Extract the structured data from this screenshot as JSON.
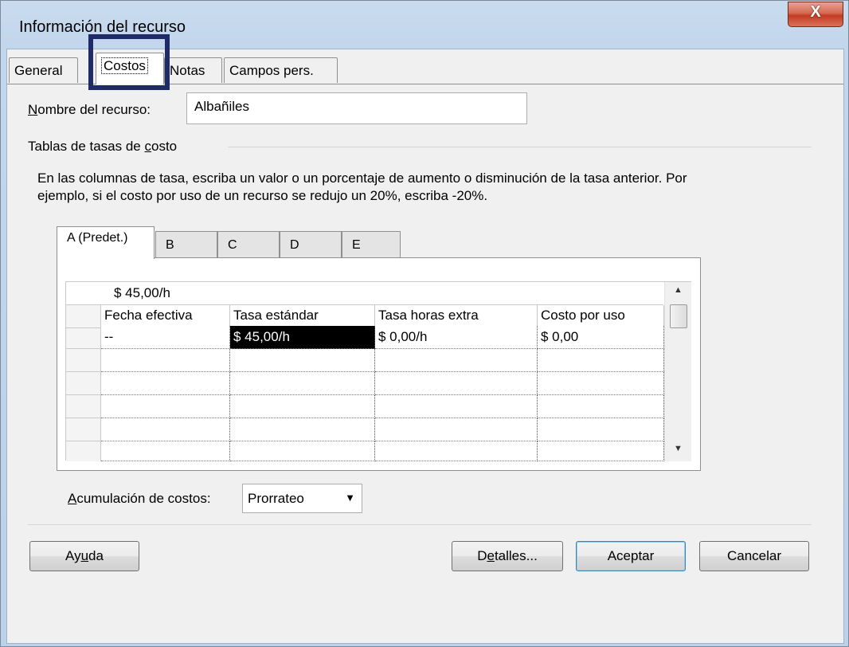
{
  "window": {
    "title": "Información del recurso",
    "close_glyph": "X"
  },
  "tabs": [
    {
      "label": "General"
    },
    {
      "label": "Costos"
    },
    {
      "label": "Notas"
    },
    {
      "label": "Campos pers."
    }
  ],
  "resource": {
    "name_label_u": "N",
    "name_label_rest": "ombre del recurso:",
    "name_value": "Albañiles"
  },
  "cost_tables": {
    "group_label_pre": "Tablas de tasas de ",
    "group_label_u": "c",
    "group_label_post": "osto",
    "description": "En las columnas de tasa, escriba un valor o un porcentaje de aumento o disminución de la tasa anterior. Por ejemplo, si el costo por uso de un recurso se redujo un 20%, escriba -20%.",
    "rate_tabs": [
      "A (Predet.)",
      "B",
      "C",
      "D",
      "E"
    ],
    "entry_value": "$ 45,00/h",
    "columns": [
      "Fecha efectiva",
      "Tasa estándar",
      "Tasa horas extra",
      "Costo por uso"
    ],
    "rows": [
      [
        "--",
        "$ 45,00/h",
        "$ 0,00/h",
        "$ 0,00"
      ],
      [
        "",
        "",
        "",
        ""
      ],
      [
        "",
        "",
        "",
        ""
      ],
      [
        "",
        "",
        "",
        ""
      ],
      [
        "",
        "",
        "",
        ""
      ],
      [
        "",
        "",
        "",
        ""
      ]
    ]
  },
  "accrual": {
    "label_u": "A",
    "label_rest": "cumulación de costos:",
    "value": "Prorrateo"
  },
  "buttons": {
    "help_pre": "Ay",
    "help_u": "u",
    "help_post": "da",
    "details_pre": "D",
    "details_u": "e",
    "details_post": "talles...",
    "ok": "Aceptar",
    "cancel": "Cancelar"
  },
  "colors": {
    "highlight_box": "#1e2b68",
    "close_button": "#c23b22",
    "selected_cell": "#000000"
  }
}
